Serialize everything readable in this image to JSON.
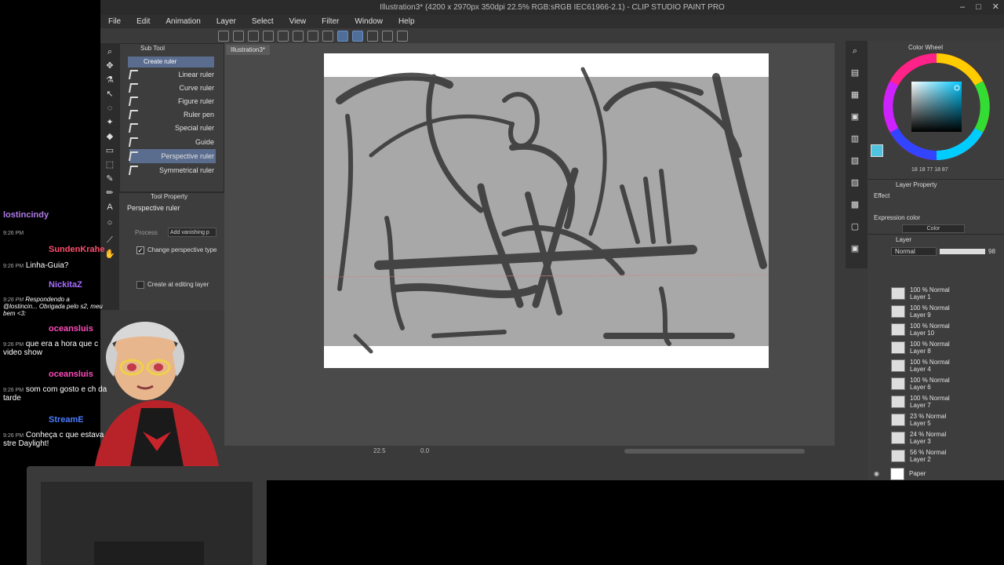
{
  "window": {
    "title": "Illustration3* (4200 x 2970px 350dpi 22.5% RGB:sRGB IEC61966-2.1) - CLIP STUDIO PAINT PRO",
    "controls": [
      "–",
      "□",
      "✕"
    ]
  },
  "menu": [
    "File",
    "Edit",
    "Animation",
    "Layer",
    "Select",
    "View",
    "Filter",
    "Window",
    "Help"
  ],
  "subtool": {
    "title": "Sub Tool",
    "group": "Create ruler",
    "items": [
      {
        "label": "Linear ruler"
      },
      {
        "label": "Curve ruler"
      },
      {
        "label": "Figure ruler"
      },
      {
        "label": "Ruler pen"
      },
      {
        "label": "Special ruler"
      },
      {
        "label": "Guide"
      },
      {
        "label": "Perspective ruler",
        "selected": true
      },
      {
        "label": "Symmetrical ruler"
      }
    ]
  },
  "toolprop": {
    "title": "Tool Property",
    "tool_name": "Perspective ruler",
    "process_label": "Process",
    "process_value": "Add vanishing p",
    "opt1": "Change perspective type",
    "opt2": "Create at editing layer",
    "eye": "eye"
  },
  "document": {
    "tab": "Illustration3*"
  },
  "status": {
    "zoom": "22.5",
    "angle": "0.0"
  },
  "color": {
    "title": "Color Wheel",
    "readout": "18 18 77 18 87",
    "swatch": "#4fc3e0"
  },
  "layer_property": {
    "title": "Layer Property",
    "effect": "Effect",
    "expression_color": "Expression color",
    "color_value": "Color"
  },
  "layer_panel": {
    "title": "Layer",
    "blend": "Normal",
    "opacity": "98",
    "layers": [
      {
        "opacity": "100 %",
        "mode": "Normal",
        "name": "Layer 1"
      },
      {
        "opacity": "100 %",
        "mode": "Normal",
        "name": "Layer 9"
      },
      {
        "opacity": "100 %",
        "mode": "Normal",
        "name": "Layer 10"
      },
      {
        "opacity": "100 %",
        "mode": "Normal",
        "name": "Layer 8"
      },
      {
        "opacity": "100 %",
        "mode": "Normal",
        "name": "Layer 4"
      },
      {
        "opacity": "100 %",
        "mode": "Normal",
        "name": "Layer 6"
      },
      {
        "opacity": "100 %",
        "mode": "Normal",
        "name": "Layer 7"
      },
      {
        "opacity": "23 %",
        "mode": "Normal",
        "name": "Layer 5"
      },
      {
        "opacity": "24 %",
        "mode": "Normal",
        "name": "Layer 3"
      },
      {
        "opacity": "56 %",
        "mode": "Normal",
        "name": "Layer 2"
      }
    ],
    "paper": "Paper"
  },
  "chat": [
    {
      "time": "",
      "user": "lostincindy",
      "color": "#b07be8",
      "text": ""
    },
    {
      "time": "9:26 PM",
      "user": "SundenKrahe",
      "color": "#ff4d6d",
      "text": ""
    },
    {
      "time": "9:26 PM",
      "user": "",
      "color": "#fff",
      "text": "Linha-Guia?"
    },
    {
      "time": "9:26 PM",
      "user": "NickitaZ",
      "color": "#a66cff",
      "text": ""
    },
    {
      "time": "9:26 PM",
      "user": "",
      "color": "#fff",
      "text": "Respondendo a @lostincin... Obrigada pelo s2, meu bem <3:"
    },
    {
      "time": "9:26 PM",
      "user": "oceansluis",
      "color": "#ff4dbb",
      "text": ""
    },
    {
      "time": "9:26 PM",
      "user": "",
      "color": "#fff",
      "text": "que era a hora que c video show"
    },
    {
      "time": "9:26 PM",
      "user": "oceansluis",
      "color": "#ff4dbb",
      "text": ""
    },
    {
      "time": "9:26 PM",
      "user": "",
      "color": "#fff",
      "text": "som com gosto e ch da tarde"
    },
    {
      "time": "9:26 PM",
      "user": "StreamE",
      "color": "#4d7cff",
      "text": ""
    },
    {
      "time": "9:26 PM",
      "user": "",
      "color": "#fff",
      "text": "Conheça c que estava stre Daylight!"
    }
  ]
}
